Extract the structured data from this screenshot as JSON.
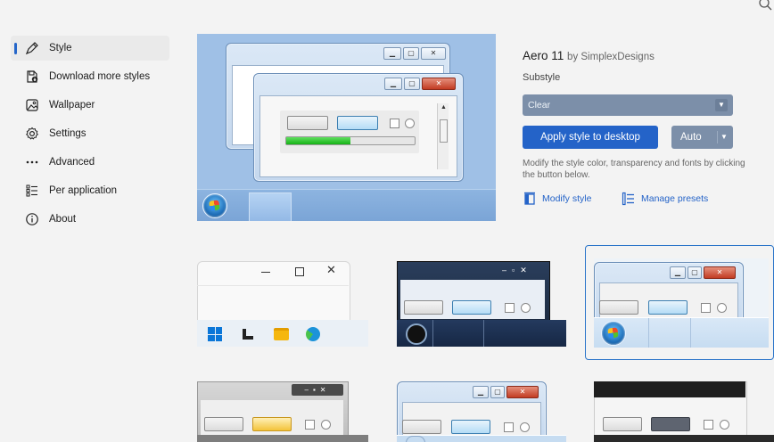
{
  "icons": {
    "top_search": "search-icon"
  },
  "sidebar": {
    "items": [
      {
        "label": "Style",
        "icon": "brush-icon",
        "active": true
      },
      {
        "label": "Download more styles",
        "icon": "download-icon"
      },
      {
        "label": "Wallpaper",
        "icon": "image-icon"
      },
      {
        "label": "Settings",
        "icon": "gear-icon"
      },
      {
        "label": "Advanced",
        "icon": "more-icon"
      },
      {
        "label": "Per application",
        "icon": "list-icon"
      },
      {
        "label": "About",
        "icon": "info-icon"
      }
    ]
  },
  "details": {
    "style_name": "Aero 11",
    "author": "by SimplexDesigns",
    "substyle_label": "Substyle",
    "substyle_value": "Clear",
    "apply_button": "Apply style to desktop",
    "mode_value": "Auto",
    "description": "Modify the style color, transparency and fonts by clicking the button below.",
    "modify_link": "Modify style",
    "presets_link": "Manage presets"
  },
  "colors": {
    "accent": "#2463c8",
    "select_bg": "#7c8fa9",
    "window_bg": "#f3f3f3"
  }
}
